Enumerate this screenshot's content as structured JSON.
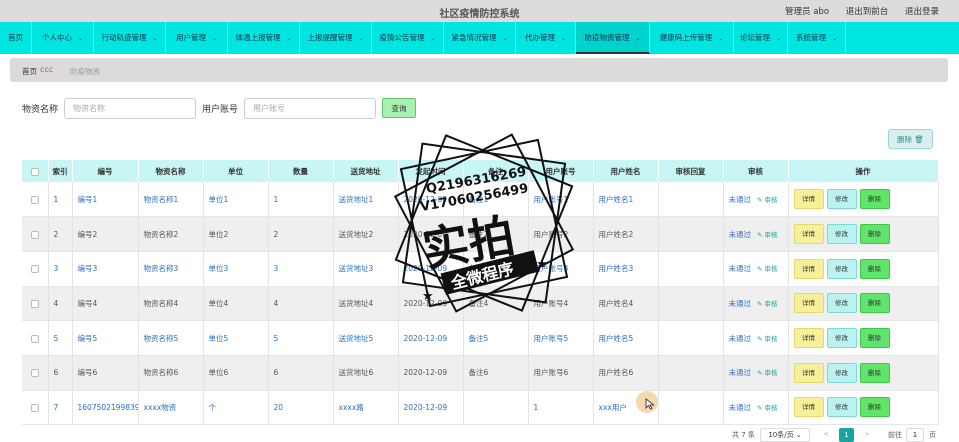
{
  "header": {
    "title": "社区疫情防控系统",
    "admin": "管理员 abo",
    "to_front": "退出到前台",
    "logout": "退出登录"
  },
  "nav": [
    {
      "label": "首页"
    },
    {
      "label": "个人中心"
    },
    {
      "label": "行动轨迹管理"
    },
    {
      "label": "用户管理"
    },
    {
      "label": "体温上报管理"
    },
    {
      "label": "上报提醒管理"
    },
    {
      "label": "疫情公告管理"
    },
    {
      "label": "紧急情况管理"
    },
    {
      "label": "代办管理"
    },
    {
      "label": "防疫物资管理"
    },
    {
      "label": "健康码上传管理"
    },
    {
      "label": "论坛管理"
    },
    {
      "label": "系统管理"
    }
  ],
  "breadcrumb": {
    "home": "首页",
    "separator": "ccc",
    "current": "防疫物资"
  },
  "search": {
    "name_label": "物资名称",
    "name_placeholder": "物资名称",
    "account_label": "用户账号",
    "account_placeholder": "用户账号",
    "query_button": "查询"
  },
  "toolbar": {
    "delete_label": "删除"
  },
  "table": {
    "columns": [
      "索引",
      "编号",
      "物资名称",
      "单位",
      "数量",
      "送货地址",
      "发起时间",
      "备注",
      "用户账号",
      "用户姓名",
      "审核回复",
      "审核",
      "操作"
    ],
    "audit_label": "审核",
    "actions": {
      "detail": "详情",
      "edit": "修改",
      "remove": "删除"
    },
    "rows": [
      {
        "index": "1",
        "code": "编号1",
        "name": "物资名称1",
        "unit": "单位1",
        "qty": "1",
        "addr": "送货地址1",
        "time": "2020-12-09",
        "note": "备注1",
        "account": "用户账号1",
        "username": "用户姓名1",
        "reply": "",
        "status": "未通过"
      },
      {
        "index": "2",
        "code": "编号2",
        "name": "物资名称2",
        "unit": "单位2",
        "qty": "2",
        "addr": "送货地址2",
        "time": "2020-12-09",
        "note": "备注2",
        "account": "用户账号2",
        "username": "用户姓名2",
        "reply": "",
        "status": "未通过"
      },
      {
        "index": "3",
        "code": "编号3",
        "name": "物资名称3",
        "unit": "单位3",
        "qty": "3",
        "addr": "送货地址3",
        "time": "2020-12-09",
        "note": "备注3",
        "account": "用户账号3",
        "username": "用户姓名3",
        "reply": "",
        "status": "未通过"
      },
      {
        "index": "4",
        "code": "编号4",
        "name": "物资名称4",
        "unit": "单位4",
        "qty": "4",
        "addr": "送货地址4",
        "time": "2020-12-09",
        "note": "备注4",
        "account": "用户账号4",
        "username": "用户姓名4",
        "reply": "",
        "status": "未通过"
      },
      {
        "index": "5",
        "code": "编号5",
        "name": "物资名称5",
        "unit": "单位5",
        "qty": "5",
        "addr": "送货地址5",
        "time": "2020-12-09",
        "note": "备注5",
        "account": "用户账号5",
        "username": "用户姓名5",
        "reply": "",
        "status": "未通过"
      },
      {
        "index": "6",
        "code": "编号6",
        "name": "物资名称6",
        "unit": "单位6",
        "qty": "6",
        "addr": "送货地址6",
        "time": "2020-12-09",
        "note": "备注6",
        "account": "用户账号6",
        "username": "用户姓名6",
        "reply": "",
        "status": "未通过"
      },
      {
        "index": "7",
        "code": "1607502199839",
        "name": "xxxx物资",
        "unit": "个",
        "qty": "20",
        "addr": "xxxx路",
        "time": "2020-12-09",
        "note": "",
        "account": "1",
        "username": "xxx用户",
        "reply": "",
        "status": "未通过"
      }
    ]
  },
  "watermark": {
    "phone1": "Q2196316269",
    "phone2": "V17060256499",
    "main": "实拍",
    "sub": "全微程序"
  },
  "pagination": {
    "total": "共 7 条",
    "page_size": "10条/页",
    "prev": "<",
    "current": "1",
    "next": ">",
    "goto_label": "前往",
    "goto_value": "1",
    "page_unit": "页"
  }
}
